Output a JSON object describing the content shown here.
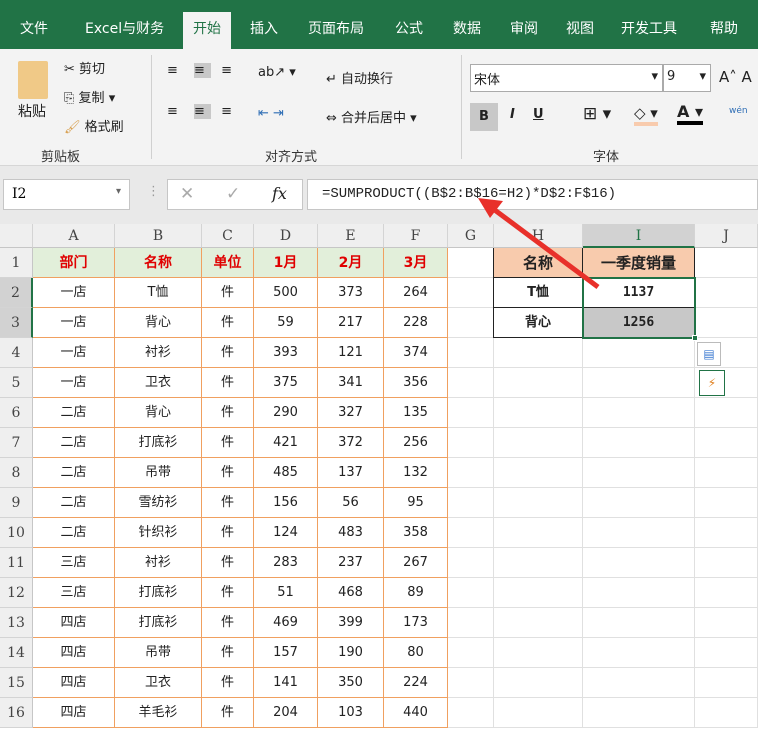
{
  "tabs": [
    "文件",
    "Excel与财务",
    "开始",
    "插入",
    "页面布局",
    "公式",
    "数据",
    "审阅",
    "视图",
    "开发工具",
    "帮助"
  ],
  "active_tab": "开始",
  "clipboard": {
    "paste": "粘贴",
    "cut": "剪切",
    "copy": "复制",
    "format_painter": "格式刷",
    "group": "剪贴板"
  },
  "alignment": {
    "wrap": "自动换行",
    "merge": "合并后居中",
    "group": "对齐方式"
  },
  "font": {
    "name": "宋体",
    "size": "9",
    "group": "字体",
    "bold": "B",
    "italic": "I",
    "underline": "U",
    "phonetic": "wén"
  },
  "name_box": "I2",
  "formula": "=SUMPRODUCT((B$2:B$16=H2)*D$2:F$16)",
  "fx": "fx",
  "columns": [
    "A",
    "B",
    "C",
    "D",
    "E",
    "F",
    "G",
    "H",
    "I",
    "J"
  ],
  "rows": [
    "1",
    "2",
    "3",
    "4",
    "5",
    "6",
    "7",
    "8",
    "9",
    "10",
    "11",
    "12",
    "13",
    "14",
    "15",
    "16"
  ],
  "table_header": [
    "部门",
    "名称",
    "单位",
    "1月",
    "2月",
    "3月"
  ],
  "table_rows": [
    [
      "一店",
      "T恤",
      "件",
      "500",
      "373",
      "264"
    ],
    [
      "一店",
      "背心",
      "件",
      "59",
      "217",
      "228"
    ],
    [
      "一店",
      "衬衫",
      "件",
      "393",
      "121",
      "374"
    ],
    [
      "一店",
      "卫衣",
      "件",
      "375",
      "341",
      "356"
    ],
    [
      "二店",
      "背心",
      "件",
      "290",
      "327",
      "135"
    ],
    [
      "二店",
      "打底衫",
      "件",
      "421",
      "372",
      "256"
    ],
    [
      "二店",
      "吊带",
      "件",
      "485",
      "137",
      "132"
    ],
    [
      "二店",
      "雪纺衫",
      "件",
      "156",
      "56",
      "95"
    ],
    [
      "二店",
      "针织衫",
      "件",
      "124",
      "483",
      "358"
    ],
    [
      "三店",
      "衬衫",
      "件",
      "283",
      "237",
      "267"
    ],
    [
      "三店",
      "打底衫",
      "件",
      "51",
      "468",
      "89"
    ],
    [
      "四店",
      "打底衫",
      "件",
      "469",
      "399",
      "173"
    ],
    [
      "四店",
      "吊带",
      "件",
      "157",
      "190",
      "80"
    ],
    [
      "四店",
      "卫衣",
      "件",
      "141",
      "350",
      "224"
    ],
    [
      "四店",
      "羊毛衫",
      "件",
      "204",
      "103",
      "440"
    ]
  ],
  "summary": {
    "header": [
      "名称",
      "一季度销量"
    ],
    "rows": [
      [
        "T恤",
        "1137"
      ],
      [
        "背心",
        "1256"
      ]
    ]
  },
  "colors": {
    "ribbon_green": "#217346",
    "header_fill": "#e2efda",
    "header_text": "#e00000",
    "summary_header_fill": "#f8cbad",
    "border_orange": "#f0a060",
    "arrow": "#e8302a"
  }
}
